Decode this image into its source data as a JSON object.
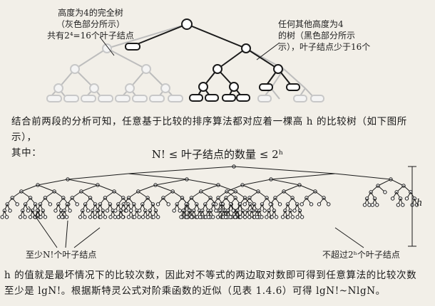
{
  "top_figure": {
    "left_note": [
      "高度为4的完全树",
      "（灰色部分所示）",
      "共有2⁴=16个叶子结点"
    ],
    "right_note": [
      "任何其他高度为4",
      "的树（黑色部分所示",
      "示），叶子结点少于16个"
    ]
  },
  "paragraph1": [
    "结合前两段的分析可知，任意基于比较的排序算法都对应着一棵高 h 的比较树（如下图所示），",
    "其中："
  ],
  "inequality": "N! ≤ 叶子结点的数量 ≤ 2ʰ",
  "big_tree": {
    "left_note": "至少N!个叶子结点",
    "right_note": "不超过2ʰ个叶子结点",
    "height_label": "h"
  },
  "paragraph2": [
    "h 的值就是最坏情况下的比较次数，因此对不等式的两边取对数即可得到任意算法的比较次数",
    "至少是 lgN!。根据斯特灵公式对阶乘函数的近似（见表 1.4.6）可得 lgN!~NlgN。"
  ],
  "colors": {
    "background": "#f2efe8",
    "gray_tree": "#bdbdbd",
    "black_tree": "#1a1a1a"
  }
}
